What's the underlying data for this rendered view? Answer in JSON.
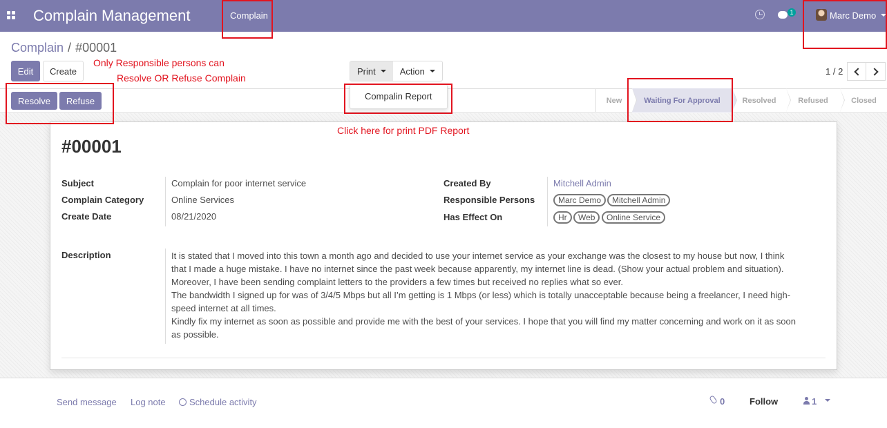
{
  "navbar": {
    "app_title": "Complain Management",
    "menu_complain": "Complain",
    "chat_badge": "1",
    "user_name": "Marc Demo",
    "background_color": "#7c7bad"
  },
  "breadcrumb": {
    "parent": "Complain",
    "separator": "/",
    "current": "#00001"
  },
  "buttons": {
    "edit": "Edit",
    "create": "Create",
    "print": "Print",
    "action": "Action",
    "resolve": "Resolve",
    "refuse": "Refuse"
  },
  "print_menu": {
    "items": [
      "Compalin Report"
    ]
  },
  "pager": {
    "value": "1 / 2"
  },
  "stages": {
    "items": [
      "New",
      "Waiting For Approval",
      "Resolved",
      "Refused",
      "Closed"
    ],
    "current": "Waiting For Approval"
  },
  "record": {
    "title": "#00001",
    "subject_label": "Subject",
    "subject": "Complain for poor internet service",
    "category_label": "Complain Category",
    "category": "Online Services",
    "date_label": "Create Date",
    "date": "08/21/2020",
    "created_by_label": "Created By",
    "created_by": "Mitchell Admin",
    "responsible_label": "Responsible Persons",
    "responsible": [
      "Marc Demo",
      "Mitchell Admin"
    ],
    "effect_label": "Has Effect On",
    "effect": [
      "Hr",
      "Web",
      "Online Service"
    ],
    "description_label": "Description",
    "description": [
      "It is stated that I moved into this town a month ago and decided to use your internet service as your exchange was the closest to my house but now, I think that I made a huge mistake. I have no internet since the past week because apparently, my internet line is dead. (Show your actual problem and situation).",
      "Moreover, I have been sending complaint letters to the providers a few times but received no replies what so ever.",
      "The bandwidth I signed up for was of 3/4/5 Mbps but all I’m getting is 1 Mbps (or less) which is totally unacceptable because being a freelancer, I need high-speed internet at all times.",
      "Kindly fix my internet as soon as possible and provide me with the best of your services. I hope that you will find my matter concerning and work on it as soon as possible."
    ]
  },
  "chatter": {
    "send_message": "Send message",
    "log_note": "Log note",
    "schedule_activity": "Schedule activity",
    "attachments": "0",
    "follow": "Follow",
    "followers": "1"
  },
  "annotations": {
    "responsible_line1": "Only Responsible persons can",
    "responsible_line2": "Resolve OR Refuse Complain",
    "print_hint": "Click here for print PDF Report",
    "color": "#e2141f"
  }
}
